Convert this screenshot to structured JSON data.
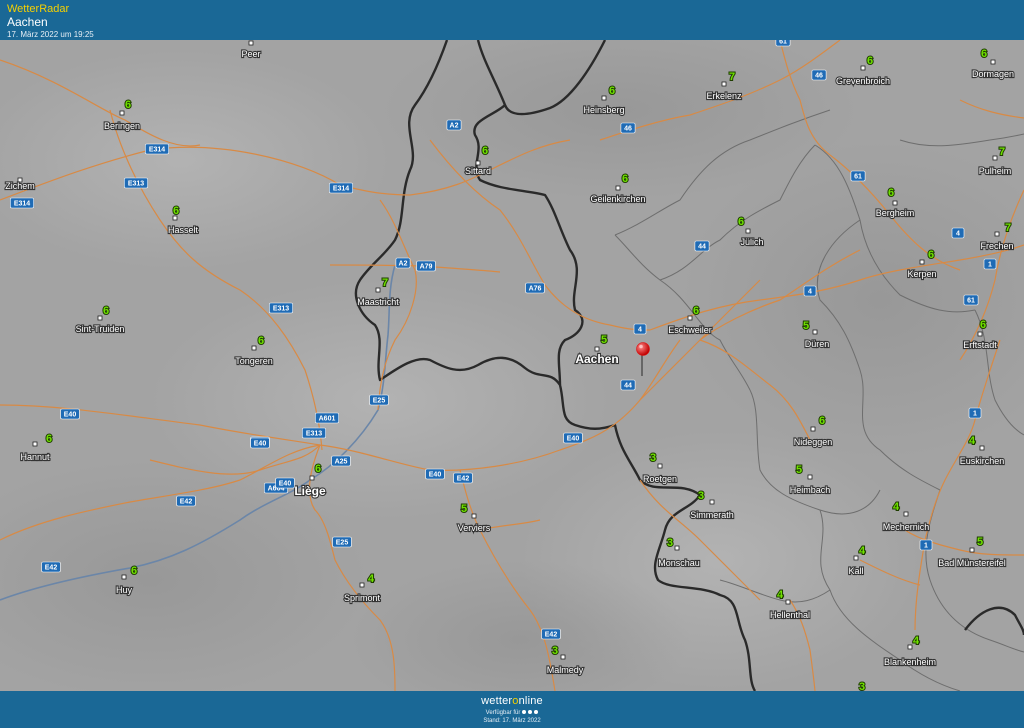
{
  "header": {
    "brand": "WetterRadar",
    "location": "Aachen",
    "timestamp": "17. März 2022 um 19:25"
  },
  "footer": {
    "logo_prefix": "wetter",
    "logo_o": "o",
    "logo_suffix": "nline",
    "available": "Verfügbar für",
    "stand": "Stand: 17. März 2022"
  },
  "map": {
    "marker_color": "#e01010",
    "cities": [
      {
        "name": "Peer",
        "temp": ""
      },
      {
        "name": "Beringen",
        "temp": "6"
      },
      {
        "name": "Zichem",
        "temp": ""
      },
      {
        "name": "Hasselt",
        "temp": "6"
      },
      {
        "name": "Sint-Truiden",
        "temp": "6"
      },
      {
        "name": "Tongeren",
        "temp": "6"
      },
      {
        "name": "Hannut",
        "temp": "6"
      },
      {
        "name": "Liège",
        "temp": "6"
      },
      {
        "name": "Huy",
        "temp": "6"
      },
      {
        "name": "Sprimont",
        "temp": "4"
      },
      {
        "name": "Verviers",
        "temp": "5"
      },
      {
        "name": "Malmedy",
        "temp": "3"
      },
      {
        "name": "Maastricht",
        "temp": "7"
      },
      {
        "name": "Sittard",
        "temp": "6"
      },
      {
        "name": "Heinsberg",
        "temp": "6"
      },
      {
        "name": "Geilenkirchen",
        "temp": "6"
      },
      {
        "name": "Erkelenz",
        "temp": "7"
      },
      {
        "name": "Grevenbroich",
        "temp": "6"
      },
      {
        "name": "Dormagen",
        "temp": "6"
      },
      {
        "name": "Pulheim",
        "temp": "7"
      },
      {
        "name": "Bergheim",
        "temp": "6"
      },
      {
        "name": "Frechen",
        "temp": "7"
      },
      {
        "name": "Kerpen",
        "temp": "6"
      },
      {
        "name": "Erftstadt",
        "temp": "6"
      },
      {
        "name": "Jülich",
        "temp": "6"
      },
      {
        "name": "Eschweiler",
        "temp": "6"
      },
      {
        "name": "Aachen",
        "temp": "5"
      },
      {
        "name": "Düren",
        "temp": "5"
      },
      {
        "name": "Roetgen",
        "temp": "3"
      },
      {
        "name": "Simmerath",
        "temp": "3"
      },
      {
        "name": "Monschau",
        "temp": "3"
      },
      {
        "name": "Nideggen",
        "temp": "6"
      },
      {
        "name": "Heimbach",
        "temp": "5"
      },
      {
        "name": "Hellenthal",
        "temp": "4"
      },
      {
        "name": "Mechernich",
        "temp": "4"
      },
      {
        "name": "Kall",
        "temp": "4"
      },
      {
        "name": "Euskirchen",
        "temp": "4"
      },
      {
        "name": "Bad Münstereifel",
        "temp": "5"
      },
      {
        "name": "Blankenheim",
        "temp": "4"
      },
      {
        "name": "",
        "temp": "3"
      }
    ],
    "roads": [
      "E314",
      "E313",
      "E314",
      "E314",
      "E313",
      "A2",
      "A2",
      "A79",
      "A76",
      "E25",
      "A601",
      "E40",
      "E40",
      "E313",
      "A25",
      "A604",
      "E42",
      "E42",
      "E25",
      "E40",
      "E42",
      "E42",
      "E40",
      "44",
      "4",
      "44",
      "46",
      "46",
      "61",
      "61",
      "4",
      "1",
      "61",
      "1",
      "4",
      "1",
      "E40",
      "E40"
    ]
  }
}
